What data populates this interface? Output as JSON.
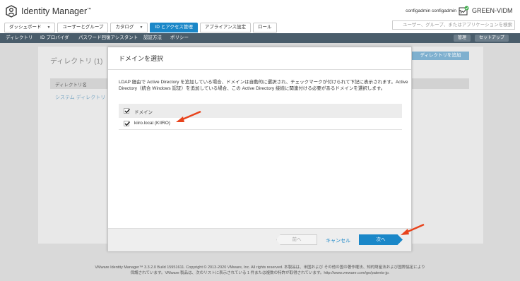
{
  "header": {
    "app_title": "Identity Manager",
    "app_title_tm": "™",
    "user": "configadmin configadmin",
    "tenant": "GREEN-VIDM"
  },
  "tabs": [
    {
      "label": "ダッシュボード",
      "dropdown": true,
      "active": false
    },
    {
      "label": "ユーザーとグループ",
      "dropdown": false,
      "active": false
    },
    {
      "label": "カタログ",
      "dropdown": true,
      "active": false
    },
    {
      "label": "ID とアクセス管理",
      "dropdown": false,
      "active": true
    },
    {
      "label": "アプライアンス設定",
      "dropdown": false,
      "active": false
    },
    {
      "label": "ロール",
      "dropdown": false,
      "active": false
    }
  ],
  "search": {
    "placeholder": "ユーザー、グループ、またはアプリケーションを検索"
  },
  "subnav": {
    "items": [
      "ディレクトリ",
      "ID プロバイダ",
      "パスワード回復アシスタント",
      "認証方法",
      "ポリシー"
    ],
    "manage_label": "管理",
    "setup_label": "セットアップ"
  },
  "background": {
    "title": "ディレクトリ (1)",
    "add_directory_label": "ディレクトリを追加",
    "table_header": "ディレクトリ名",
    "row_label": "システム ディレクトリ"
  },
  "modal": {
    "title": "ドメインを選択",
    "description": "LDAP 経由で Active Directory を追加している場合、ドメインは自動的に選択され、チェックマークが付けられて下記に表示されます。Active Directory（統合 Windows 認証）を追加している場合、この Active Directory 接続に関連付ける必要があるドメインを選択します。",
    "domain_header": "ドメイン",
    "domains": [
      {
        "label": "kiiro.local (KIIRO)",
        "checked": true
      }
    ],
    "back_label": "前へ",
    "cancel_label": "キャンセル",
    "next_label": "次へ"
  },
  "footer": {
    "line1": "VMware Identity Manager™ 3.3.2.0 Build 15951611. Copyright © 2013-2020 VMware, Inc. All rights reserved. 本製品は、米国および その他の国の著作権法、知的財産法および国際協定により",
    "line2": "保護されています。VMware 製品は、次のリストに表示されている 1 件または複数の特許が取得されています。http://www.vmware.com/go/patents-jp."
  },
  "colors": {
    "accent": "#1a87c8",
    "annotation_arrow": "#e8431c",
    "subnav_bg": "#4a5d6b"
  }
}
